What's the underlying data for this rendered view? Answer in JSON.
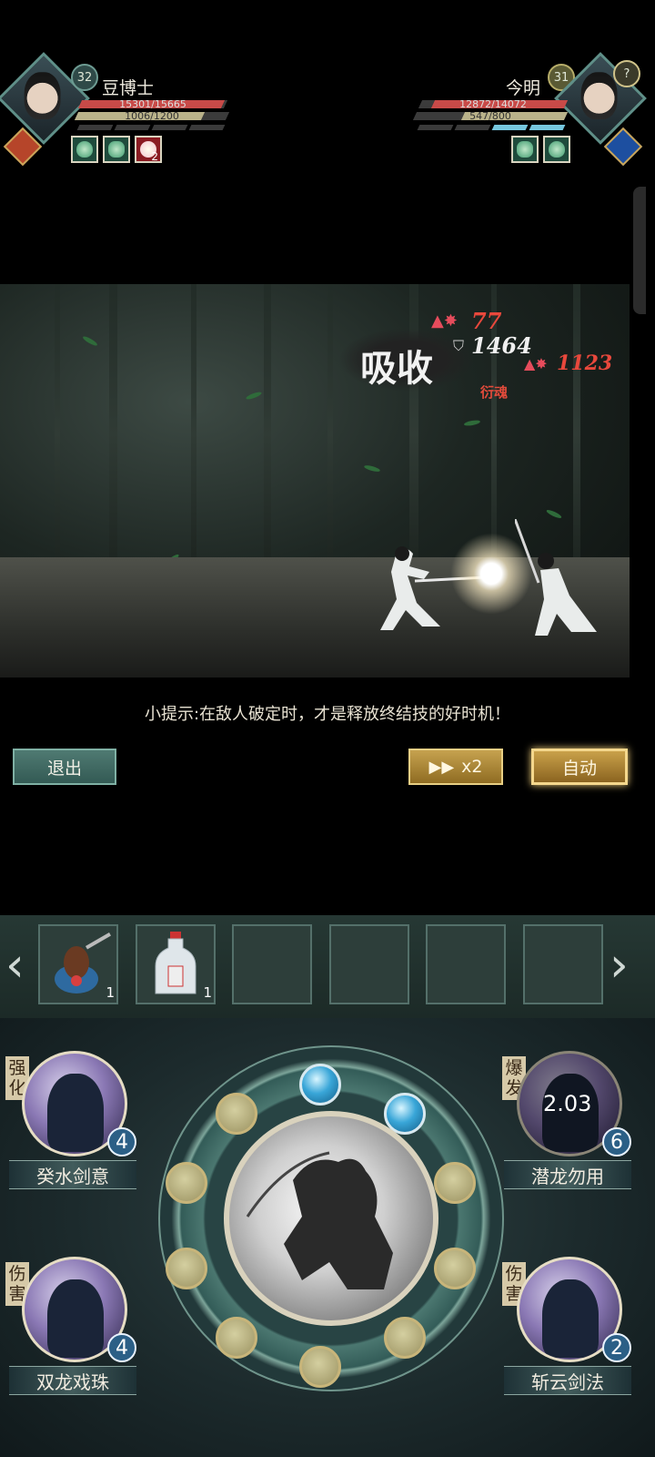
{
  "player": {
    "name": "豆博士",
    "level": "32",
    "hp": "15301/15665",
    "qi": "1006/1200",
    "buff_count": "2"
  },
  "enemy": {
    "name": "今明",
    "level": "31",
    "hp": "12872/14072",
    "qi": "547/800",
    "help": "?"
  },
  "battle": {
    "effect_text": "吸收",
    "effect_sub": "衍魂",
    "damage_1": "77",
    "damage_2": "1464",
    "damage_3": "1123"
  },
  "hint": "小提示:在敌人破定时，才是释放终结技的好时机！",
  "controls": {
    "exit": "退出",
    "speed": "x2",
    "auto": "自动"
  },
  "items": [
    {
      "icon": "incense-burner-icon",
      "count": "1"
    },
    {
      "icon": "medicine-bottle-icon",
      "count": "1"
    }
  ],
  "skills": {
    "s1": {
      "name": "癸水剑意",
      "tag": "强化",
      "count": "4"
    },
    "s2": {
      "name": "潜龙勿用",
      "tag": "爆发",
      "count": "6",
      "cooldown": "2.03"
    },
    "s3": {
      "name": "双龙戏珠",
      "tag": "伤害",
      "count": "4"
    },
    "s4": {
      "name": "斩云剑法",
      "tag": "伤害",
      "count": "2"
    }
  },
  "colors": {
    "hp": "#d14c4c",
    "qi": "#c5bd92",
    "gold": "#c9a14a",
    "teal": "#4f7a72",
    "orb_blue": "#39a6d8"
  }
}
